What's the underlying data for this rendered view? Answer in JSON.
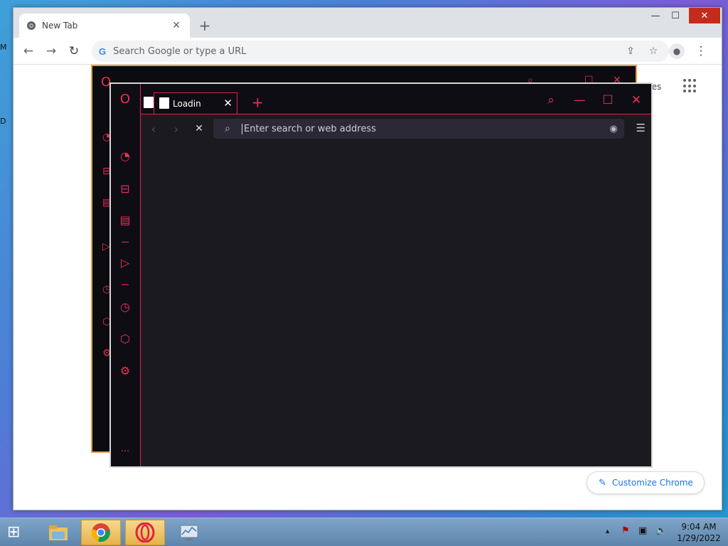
{
  "desktop": {
    "sliver1": "M",
    "sliver2": "D"
  },
  "chrome": {
    "tab_title": "New Tab",
    "tab_close": "✕",
    "new_tab": "+",
    "window_controls": {
      "minimize": "—",
      "maximize": "☐",
      "close": "✕"
    },
    "nav": {
      "back": "←",
      "forward": "→",
      "reload": "↻"
    },
    "omnibox_prefix": "G",
    "omnibox_placeholder": "Search Google or type a URL",
    "omnibox_icons": [
      "share-icon",
      "star-icon",
      "profile-icon",
      "menu-icon"
    ],
    "omnibox_glyphs": {
      "share": "⇪",
      "star": "☆",
      "profile": "●",
      "menu": "⋮"
    },
    "partial_link": "ges",
    "customize_label": "Customize Chrome",
    "customize_icon": "✎"
  },
  "opera": {
    "tab_label": "Loading",
    "tab_close": "✕",
    "new_tab": "+",
    "controls": {
      "search": "⌕",
      "minimize": "—",
      "maximize": "☐",
      "close": "✕"
    },
    "nav": {
      "back": "‹",
      "forward": "›",
      "stop": "✕"
    },
    "address_placeholder": "Enter search or web address",
    "search_glyph": "⌕",
    "camera_glyph": "◉",
    "easy_setup_glyph": "☰",
    "accent_color": "#e8305a",
    "sidebar": {
      "logo": "O",
      "speed_dial": "◔",
      "bag": "⊟",
      "twitch": "▤",
      "player": "▷",
      "history": "◷",
      "cube": "⬡",
      "settings": "⚙",
      "more": "···"
    }
  },
  "taskbar": {
    "start_glyph": "⊞",
    "tray": {
      "up": "▴",
      "flag": "⚑",
      "network": "▣",
      "volume": "🔈"
    },
    "time": "9:04 AM",
    "date": "1/29/2022"
  }
}
